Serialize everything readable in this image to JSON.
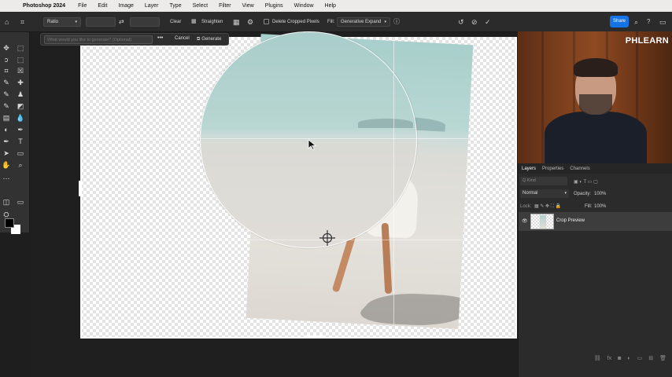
{
  "menubar": {
    "app_name": "Photoshop 2024",
    "items": [
      "File",
      "Edit",
      "Image",
      "Layer",
      "Type",
      "Select",
      "Filter",
      "View",
      "Plugins",
      "Window",
      "Help"
    ]
  },
  "options_bar": {
    "ratio_label": "Ratio",
    "clear_label": "Clear",
    "straighten_label": "Straighten",
    "delete_cropped_label": "Delete Cropped Pixels",
    "fill_label": "Fill:",
    "fill_value": "Generative Expand",
    "share_label": "Share",
    "accent_color": "#1473e6"
  },
  "contextual_bar": {
    "prompt_placeholder": "What would you like to generate? (Optional)",
    "cancel_label": "Cancel",
    "generate_label": "Generate"
  },
  "webcam": {
    "logo": "PHLEARN"
  },
  "layers_panel": {
    "tabs": [
      "Layers",
      "Properties",
      "Channels"
    ],
    "kind_placeholder": "Q Kind",
    "blend_mode": "Normal",
    "opacity_label": "Opacity:",
    "opacity_value": "100%",
    "lock_label": "Lock:",
    "fill_label": "Fill:",
    "fill_value": "100%",
    "layer_name": "Crop Preview"
  }
}
